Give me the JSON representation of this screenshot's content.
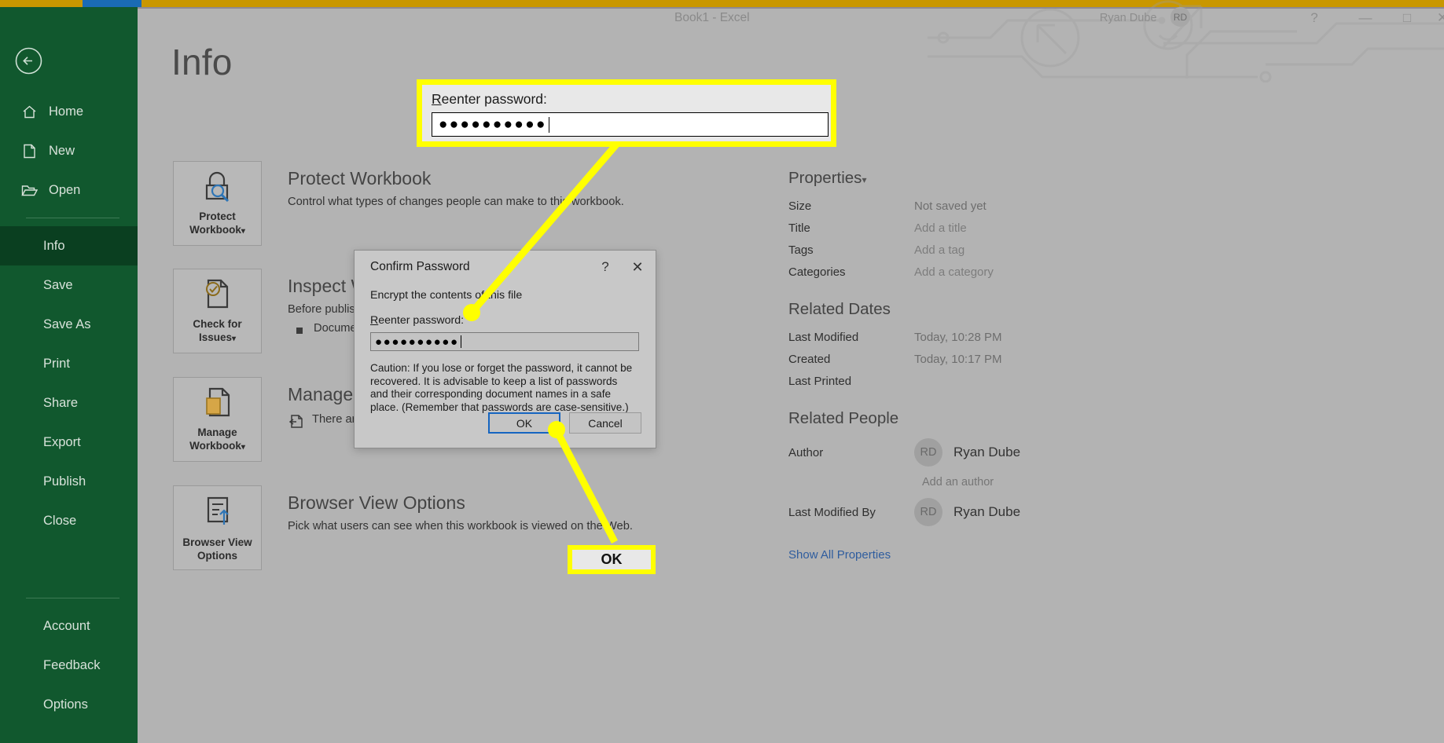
{
  "titlebar": {
    "document_title": "Book1  -  Excel",
    "user_name": "Ryan Dube",
    "user_initials": "RD",
    "help_icon": "?",
    "minimize_icon": "—",
    "maximize_icon": "□",
    "close_icon": "✕"
  },
  "sidebar": {
    "back_icon": "back-arrow-circle-icon",
    "items": [
      {
        "label": "Home",
        "icon": "home-icon"
      },
      {
        "label": "New",
        "icon": "new-document-icon"
      },
      {
        "label": "Open",
        "icon": "open-folder-icon"
      },
      {
        "label": "Info",
        "icon": ""
      },
      {
        "label": "Save",
        "icon": ""
      },
      {
        "label": "Save As",
        "icon": ""
      },
      {
        "label": "Print",
        "icon": ""
      },
      {
        "label": "Share",
        "icon": ""
      },
      {
        "label": "Export",
        "icon": ""
      },
      {
        "label": "Publish",
        "icon": ""
      },
      {
        "label": "Close",
        "icon": ""
      }
    ],
    "active_item": "Info",
    "bottom_items": [
      {
        "label": "Account"
      },
      {
        "label": "Feedback"
      },
      {
        "label": "Options"
      }
    ]
  },
  "main": {
    "page_title": "Info",
    "sections": [
      {
        "tile_label_line1": "Protect",
        "tile_label_line2": "Workbook",
        "tile_caret": "▾",
        "tile_icon": "lock-magnifier-icon",
        "title": "Protect Workbook",
        "desc": "Control what types of changes people can make to this workbook."
      },
      {
        "tile_label_line1": "Check for",
        "tile_label_line2": "Issues",
        "tile_caret": "▾",
        "tile_icon": "document-check-icon",
        "title": "Inspect Workbook",
        "desc": "Before publishing this file, be aware that it contains:",
        "bullet": "Document properties and author's name"
      },
      {
        "tile_label_line1": "Manage",
        "tile_label_line2": "Workbook",
        "tile_caret": "▾",
        "tile_icon": "document-manage-icon",
        "title": "Manage Workbook",
        "desc": "",
        "bullet": "There are no unsaved changes."
      },
      {
        "tile_label_line1": "Browser View",
        "tile_label_line2": "Options",
        "tile_caret": "",
        "tile_icon": "browser-view-icon",
        "title": "Browser View Options",
        "desc": "Pick what users can see when this workbook is viewed on the Web."
      }
    ]
  },
  "properties": {
    "heading": "Properties",
    "caret": "▾",
    "rows": [
      {
        "key": "Size",
        "value": "Not saved yet"
      },
      {
        "key": "Title",
        "value": "Add a title"
      },
      {
        "key": "Tags",
        "value": "Add a tag"
      },
      {
        "key": "Categories",
        "value": "Add a category"
      }
    ],
    "related_dates_heading": "Related Dates",
    "dates": [
      {
        "key": "Last Modified",
        "value": "Today, 10:28 PM"
      },
      {
        "key": "Created",
        "value": "Today, 10:17 PM"
      },
      {
        "key": "Last Printed",
        "value": ""
      }
    ],
    "related_people_heading": "Related People",
    "author_key": "Author",
    "author_initials": "RD",
    "author_name": "Ryan Dube",
    "add_author": "Add an author",
    "last_modified_by_key": "Last Modified By",
    "last_modified_by_initials": "RD",
    "last_modified_by_name": "Ryan Dube",
    "show_all": "Show All Properties"
  },
  "dialog": {
    "title": "Confirm Password",
    "help_icon": "?",
    "close_icon": "✕",
    "line1": "Encrypt the contents of this file",
    "label_accel": "R",
    "label_rest": "eenter password:",
    "password_mask": "●●●●●●●●●●",
    "caution": "Caution: If you lose or forget the password, it cannot be recovered. It is advisable to keep a list of passwords and their corresponding document names in a safe place. (Remember that passwords are case-sensitive.)",
    "ok_label": "OK",
    "cancel_label": "Cancel"
  },
  "annotations": {
    "password_callout": {
      "label_accel": "R",
      "label_rest": "eenter password:",
      "value": "●●●●●●●●●●"
    },
    "ok_callout": {
      "label": "OK"
    }
  },
  "colors": {
    "accent_gold": "#c99700",
    "accent_blue": "#1a6bb5",
    "sidebar_green": "#11582e",
    "sidebar_active_green": "#0a3f20",
    "highlight_yellow": "#ffff00",
    "dialog_default_btn_blue": "#1565c0",
    "link_blue": "#2f5d9e",
    "backdrop_gray": "#b3b3b3"
  }
}
